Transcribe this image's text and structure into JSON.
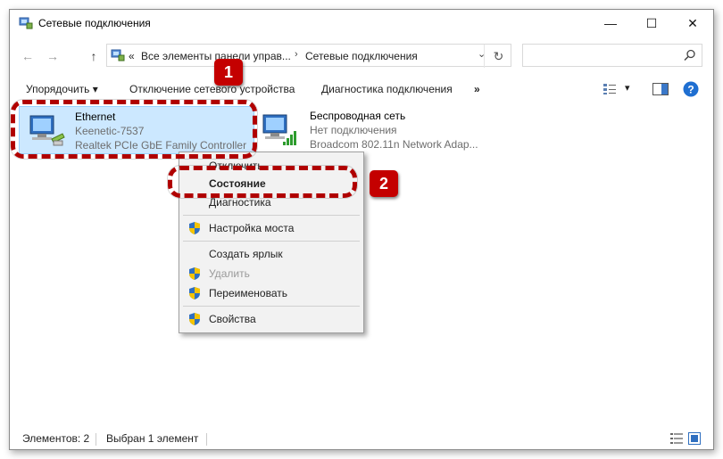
{
  "window": {
    "title": "Сетевые подключения",
    "minimize_glyph": "—",
    "maximize_glyph": "☐",
    "close_glyph": "✕"
  },
  "address": {
    "back_glyph": "←",
    "forward_glyph": "→",
    "up_glyph": "↑",
    "overflow": "«",
    "crumb1": "Все элементы панели управ...",
    "sep": "›",
    "crumb2": "Сетевые подключения",
    "refresh_glyph": "↻",
    "search_placeholder": ""
  },
  "toolbar": {
    "organize": "Упорядочить ▾",
    "disable": "Отключение сетевого устройства",
    "diagnose": "Диагностика подключения",
    "more": "»",
    "view_dropdown": "▾"
  },
  "connections": [
    {
      "name": "Ethernet",
      "network": "Keenetic-7537",
      "adapter": "Realtek PCIe GbE Family Controller",
      "icon": "ethernet-adapter-icon",
      "selected": true
    },
    {
      "name": "Беспроводная сеть",
      "network": "Нет подключения",
      "adapter": "Broadcom 802.11n Network Adap...",
      "icon": "wireless-adapter-icon",
      "selected": false
    }
  ],
  "context_menu": {
    "items": [
      {
        "label": "Отключить",
        "bold": false,
        "disabled": false,
        "shield": true
      },
      {
        "label": "Состояние",
        "bold": true,
        "disabled": false,
        "shield": false
      },
      {
        "label": "Диагностика",
        "bold": false,
        "disabled": false,
        "shield": false
      },
      {
        "label": "Настройка моста",
        "bold": false,
        "disabled": false,
        "shield": true
      },
      {
        "label": "Создать ярлык",
        "bold": false,
        "disabled": false,
        "shield": false
      },
      {
        "label": "Удалить",
        "bold": false,
        "disabled": true,
        "shield": true
      },
      {
        "label": "Переименовать",
        "bold": false,
        "disabled": false,
        "shield": true
      },
      {
        "label": "Свойства",
        "bold": false,
        "disabled": false,
        "shield": true
      }
    ]
  },
  "callouts": {
    "step1": "1",
    "step2": "2",
    "color": "#c40000"
  },
  "status": {
    "count": "Элементов: 2",
    "selected": "Выбран 1 элемент"
  },
  "colors": {
    "selection_bg": "#cce8ff",
    "selection_border": "#99d1ff",
    "help_blue": "#1f6fd1"
  }
}
